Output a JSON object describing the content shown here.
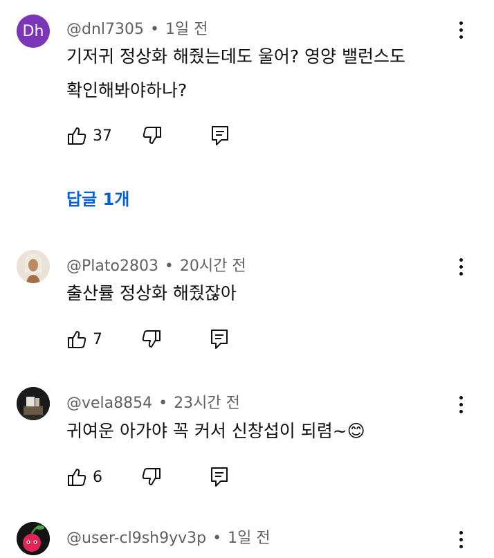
{
  "comments": [
    {
      "avatar_initials": "Dh",
      "author": "@dnl7305",
      "time": "1일 전",
      "text_lines": [
        "기저귀 정상화 해줬는데도 울어? 영양 밸런스도",
        "확인해봐야하나?"
      ],
      "likes": "37",
      "replies_label": "답글 1개"
    },
    {
      "author": "@Plato2803",
      "time": "20시간 전",
      "text_lines": [
        "출산률 정상화 해줬잖아"
      ],
      "likes": "7"
    },
    {
      "author": "@vela8854",
      "time": "23시간 전",
      "text_lines": [
        "귀여운 아가야 꼭 커서 신창섭이 되렴~😊"
      ],
      "likes": "6"
    },
    {
      "author": "@user-cl9sh9yv3p",
      "time": "1일 전",
      "text_lines": []
    }
  ],
  "icons": {
    "like": "thumbs-up-icon",
    "dislike": "thumbs-down-icon",
    "reply": "reply-icon",
    "more": "more-vert-icon"
  },
  "colors": {
    "link": "#065fd4",
    "meta": "#606060",
    "avatar_dh": "#7b35b7"
  }
}
